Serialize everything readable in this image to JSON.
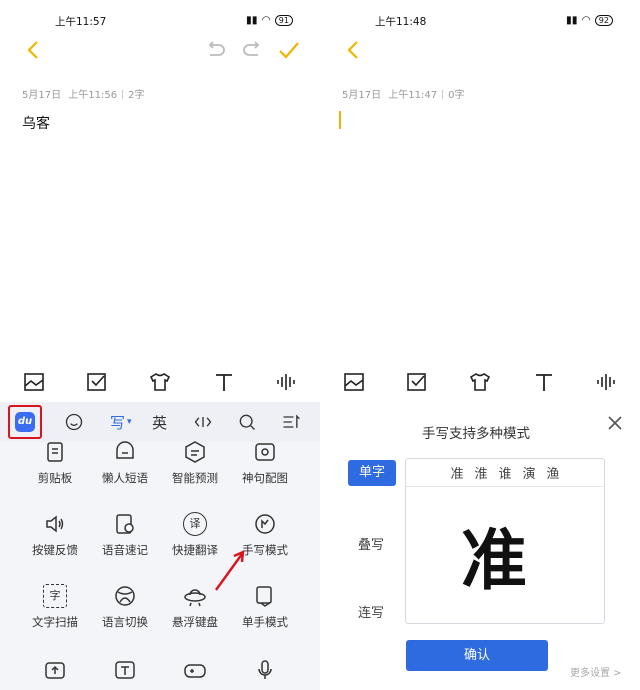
{
  "left": {
    "status_time": "上午11:57",
    "battery": "91",
    "meta_date": "5月17日",
    "meta_time": "上午11:56",
    "meta_count": "2字",
    "note_text": "乌客",
    "keyboard": {
      "tabs": [
        "写",
        "英"
      ],
      "du_label": "du",
      "items": [
        {
          "label": "剪贴板"
        },
        {
          "label": "懒人短语"
        },
        {
          "label": "智能预测"
        },
        {
          "label": "神句配图"
        },
        {
          "label": "按键反馈"
        },
        {
          "label": "语音速记"
        },
        {
          "label": "快捷翻译"
        },
        {
          "label": "手写模式"
        },
        {
          "label": "文字扫描"
        },
        {
          "label": "语言切换"
        },
        {
          "label": "悬浮键盘"
        },
        {
          "label": "单手模式"
        }
      ],
      "icon_glyphs": {
        "translate": "译",
        "scan": "字"
      }
    }
  },
  "right": {
    "status_time": "上午11:48",
    "battery": "92",
    "meta_date": "5月17日",
    "meta_time": "上午11:47",
    "meta_count": "0字",
    "handwriting": {
      "title": "手写支持多种模式",
      "modes": [
        "单字",
        "叠写",
        "连写"
      ],
      "candidates": [
        "准",
        "淮",
        "谁",
        "演",
        "渔"
      ],
      "drawn_char": "准",
      "confirm": "确认",
      "more_settings": "更多设置 >"
    }
  },
  "colors": {
    "accent_yellow": "#f0b400",
    "accent_blue": "#2f6be0",
    "highlight_red": "#d8141f"
  }
}
